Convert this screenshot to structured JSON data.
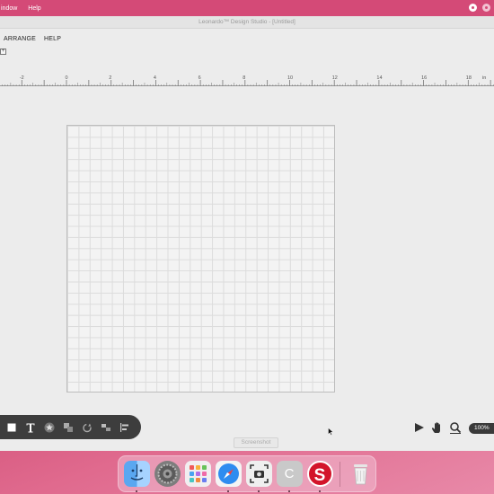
{
  "menubar": {
    "items": [
      "Window",
      "Help"
    ],
    "visible_items": [
      "indow",
      "Help"
    ]
  },
  "window": {
    "title": "Leonardo™ Design Studio - [Untitled]"
  },
  "app_menu": [
    "ARRANGE",
    "HELP"
  ],
  "ruler": {
    "unit": "in",
    "labels": [
      "-2",
      "0",
      "2",
      "4",
      "6",
      "8",
      "10",
      "12",
      "14",
      "16",
      "18"
    ]
  },
  "toolbar": {
    "tools": [
      "rectangle-icon",
      "text-icon",
      "star-icon",
      "shapes-icon",
      "rotate-icon",
      "group-icon",
      "align-icon"
    ]
  },
  "right_tools": {
    "tools": [
      "select-arrow-icon",
      "hand-pan-icon",
      "zoom-magnifier-icon"
    ],
    "zoom_label": "100%"
  },
  "tooltip": "Screenshot",
  "dock": {
    "apps": [
      "Finder",
      "System Preferences",
      "Launchpad",
      "Safari",
      "Screenshot",
      "Chrome",
      "Leonardo",
      "Trash"
    ]
  },
  "colors": {
    "menubar": "#d44a77",
    "window_bg": "#ececec",
    "toolbar_bg": "#3d3d3d",
    "accent_red": "#d3142a"
  }
}
